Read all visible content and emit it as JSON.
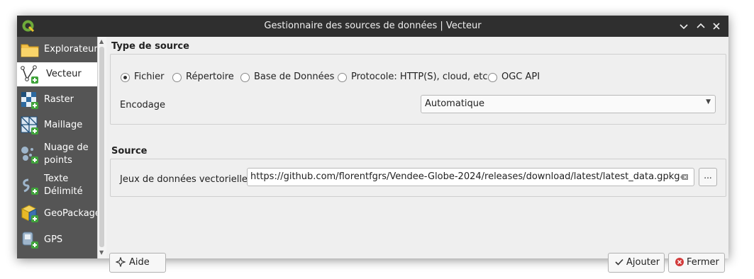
{
  "window": {
    "title": "Gestionnaire des sources de données | Vecteur"
  },
  "sidebar": {
    "items": [
      {
        "label": "Explorateur",
        "icon": "folder-icon"
      },
      {
        "label": "Vecteur",
        "icon": "vector-icon"
      },
      {
        "label": "Raster",
        "icon": "raster-icon"
      },
      {
        "label": "Maillage",
        "icon": "mesh-icon"
      },
      {
        "label": "Nuage de points",
        "label_line1": "Nuage de",
        "label_line2": "points",
        "icon": "point-cloud-icon"
      },
      {
        "label": "Texte Délimité",
        "label_line1": "Texte",
        "label_line2": "Délimité",
        "icon": "delimited-text-icon"
      },
      {
        "label": "GeoPackage",
        "icon": "geopackage-icon"
      },
      {
        "label": "GPS",
        "icon": "gps-icon"
      }
    ],
    "active": "Vecteur"
  },
  "source_type": {
    "title": "Type de source",
    "options": [
      {
        "label": "Fichier",
        "checked": true
      },
      {
        "label": "Répertoire",
        "checked": false
      },
      {
        "label": "Base de Données",
        "checked": false
      },
      {
        "label": "Protocole: HTTP(S), cloud, etc.",
        "checked": false
      },
      {
        "label": "OGC API",
        "checked": false
      }
    ],
    "encoding_label": "Encodage",
    "encoding_value": "Automatique"
  },
  "source": {
    "title": "Source",
    "dataset_label": "Jeux de données vectorielles",
    "dataset_value": "https://github.com/florentfgrs/Vendee-Globe-2024/releases/download/latest/latest_data.gpkg",
    "browse_label": "..."
  },
  "buttons": {
    "help": "Aide",
    "add": "Ajouter",
    "close": "Fermer"
  },
  "colors": {
    "titlebar": "#2f2f2f",
    "sidebar": "#555555",
    "background": "#efefef",
    "close_red": "#d23b3b",
    "qgis_green": "#6eaa3a"
  }
}
